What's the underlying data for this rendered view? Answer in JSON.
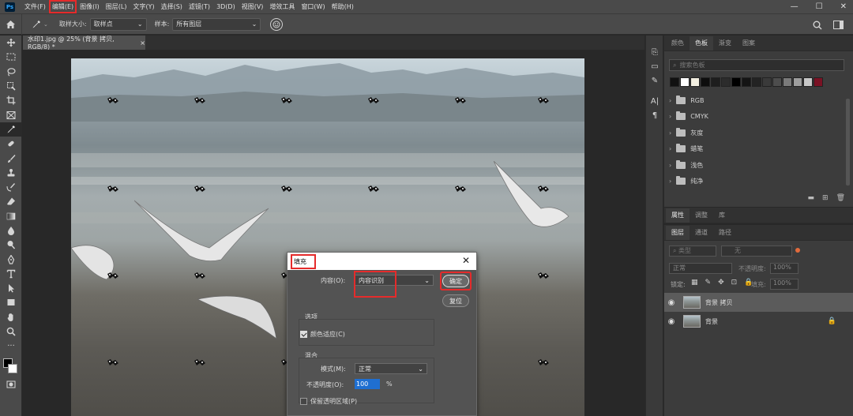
{
  "app": {
    "logo": "Ps"
  },
  "menu": [
    {
      "label": "文件(F)",
      "highlight": false
    },
    {
      "label": "编辑(E)",
      "highlight": true
    },
    {
      "label": "图像(I)",
      "highlight": false
    },
    {
      "label": "图层(L)",
      "highlight": false
    },
    {
      "label": "文字(Y)",
      "highlight": false
    },
    {
      "label": "选择(S)",
      "highlight": false
    },
    {
      "label": "滤镜(T)",
      "highlight": false
    },
    {
      "label": "3D(D)",
      "highlight": false
    },
    {
      "label": "视图(V)",
      "highlight": false
    },
    {
      "label": "增效工具",
      "highlight": false
    },
    {
      "label": "窗口(W)",
      "highlight": false
    },
    {
      "label": "帮助(H)",
      "highlight": false
    }
  ],
  "window_controls": {
    "minimize": "—",
    "maximize": "☐",
    "close": "✕"
  },
  "options_bar": {
    "sample_size_label": "取样大小:",
    "sample_size_value": "取样点",
    "sample_label": "样本:",
    "sample_value": "所有图层"
  },
  "document": {
    "tab_title": "水印1.jpg @ 25% (背景 拷贝, RGB/8) *",
    "close": "×"
  },
  "fill_dialog": {
    "title": "填充",
    "content_label": "内容(O):",
    "content_value": "内容识别",
    "ok_label": "确定",
    "reset_label": "复位",
    "options_label": "选项",
    "color_adapt_label": "颜色适应(C)",
    "color_adapt_checked": true,
    "blend_label": "混合",
    "mode_label": "模式(M):",
    "mode_value": "正常",
    "opacity_label": "不透明度(O):",
    "opacity_value": "100",
    "opacity_unit": "%",
    "preserve_label": "保留透明区域(P)",
    "preserve_checked": false
  },
  "swatches_panel": {
    "tabs": [
      "颜色",
      "色板",
      "渐变",
      "图案"
    ],
    "active_tab": "色板",
    "search_placeholder": "搜索色板",
    "colors": [
      "#111111",
      "#ffffff",
      "#f2eee0",
      "#0d0d0d",
      "#1e1e1e",
      "#2c2c2c",
      "#000000",
      "#141414",
      "#232323",
      "#3a3a3a",
      "#4d4d4d",
      "#7a7a7a",
      "#9e9e9e",
      "#c8c8c8",
      "#7a1224"
    ],
    "folders": [
      "RGB",
      "CMYK",
      "灰度",
      "蜡笔",
      "浅色",
      "纯净"
    ]
  },
  "properties_panel": {
    "tabs": [
      "属性",
      "调整",
      "库"
    ],
    "active_tab": "属性"
  },
  "layers_panel": {
    "tabs": [
      "图层",
      "通道",
      "路径"
    ],
    "active_tab": "图层",
    "filter_placeholder": "类型",
    "filter_mode": "无",
    "blend_mode": "正常",
    "opacity_label": "不透明度:",
    "opacity_value": "100%",
    "lock_label": "锁定:",
    "fill_label": "填充:",
    "fill_value": "100%",
    "layers": [
      {
        "name": "背景 拷贝",
        "selected": true,
        "locked": false
      },
      {
        "name": "背景",
        "selected": false,
        "locked": true
      }
    ]
  }
}
